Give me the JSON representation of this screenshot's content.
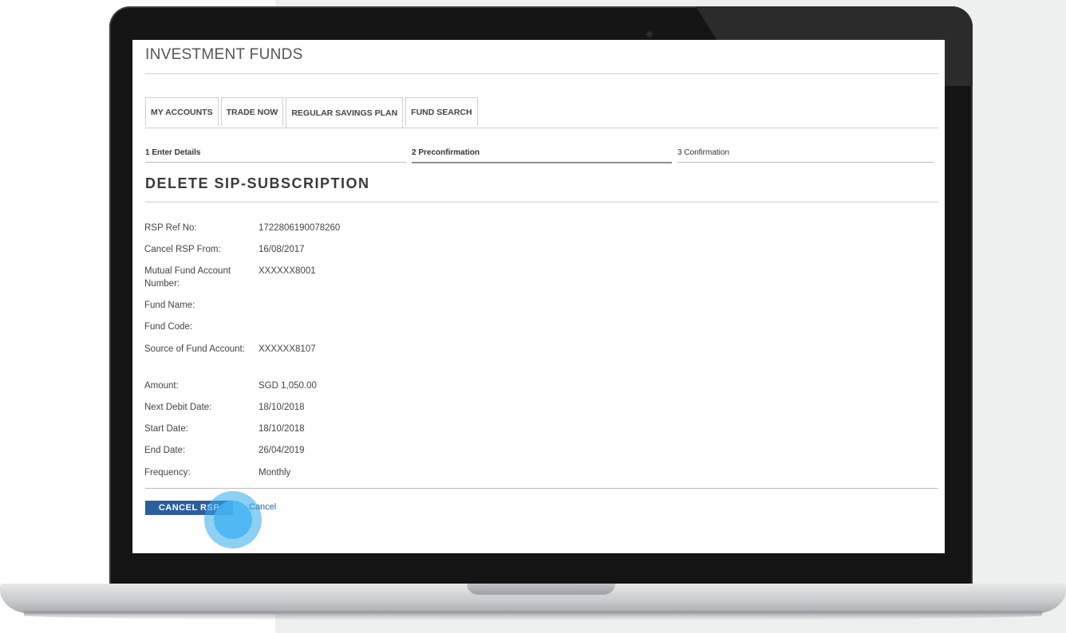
{
  "header": {
    "title": "INVESTMENT FUNDS"
  },
  "tabs": [
    {
      "label": "MY ACCOUNTS"
    },
    {
      "label": "TRADE NOW"
    },
    {
      "label": "REGULAR SAVINGS PLAN"
    },
    {
      "label": "FUND SEARCH"
    }
  ],
  "steps": [
    {
      "label": "1 Enter Details"
    },
    {
      "label": "2 Preconfirmation"
    },
    {
      "label": "3 Confirmation"
    }
  ],
  "section": {
    "title": "DELETE SIP-SUBSCRIPTION"
  },
  "details": [
    {
      "label": "RSP Ref No:",
      "value": "1722806190078260"
    },
    {
      "label": "Cancel RSP From:",
      "value": "16/08/2017"
    },
    {
      "label": "Mutual Fund Account Number:",
      "value": "XXXXXX8001"
    },
    {
      "label": "Fund Name:",
      "value": ""
    },
    {
      "label": "Fund Code:",
      "value": ""
    },
    {
      "label": "Source of Fund Account:",
      "value": "XXXXXX8107"
    },
    {
      "label": "Amount:",
      "value": "SGD 1,050.00"
    },
    {
      "label": "Next Debit Date:",
      "value": "18/10/2018"
    },
    {
      "label": "Start Date:",
      "value": "18/10/2018"
    },
    {
      "label": "End Date:",
      "value": "26/04/2019"
    },
    {
      "label": "Frequency:",
      "value": "Monthly"
    }
  ],
  "actions": {
    "cancel_rsp_label": "CANCEL RSP",
    "cancel_label": "Cancel"
  },
  "colors": {
    "primary_button": "#2c5e9e",
    "touch_indicator": "#2daaeb"
  }
}
